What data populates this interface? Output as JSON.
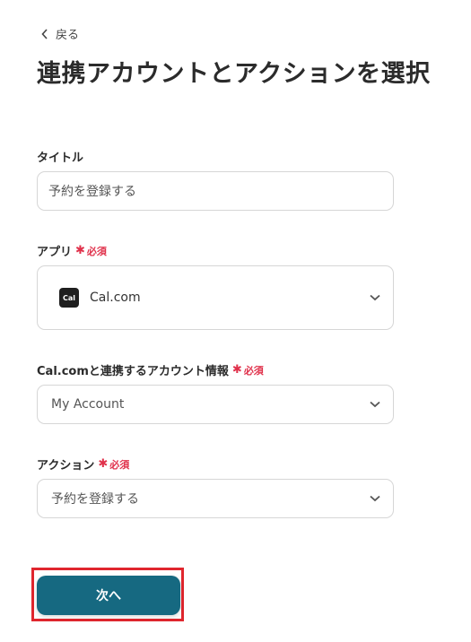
{
  "nav": {
    "back_label": "戻る"
  },
  "page": {
    "title": "連携アカウントとアクションを選択"
  },
  "form": {
    "title_field": {
      "label": "タイトル",
      "value": "予約を登録する"
    },
    "app_field": {
      "label": "アプリ",
      "required": "必須",
      "app_logo_text": "Cal",
      "value": "Cal.com"
    },
    "account_field": {
      "label": "Cal.comと連携するアカウント情報",
      "required": "必須",
      "value": "My Account"
    },
    "action_field": {
      "label": "アクション",
      "required": "必須",
      "value": "予約を登録する"
    }
  },
  "footer": {
    "next_label": "次へ"
  },
  "colors": {
    "primary": "#166981",
    "required": "#e0314b",
    "highlight": "#e0262e"
  }
}
